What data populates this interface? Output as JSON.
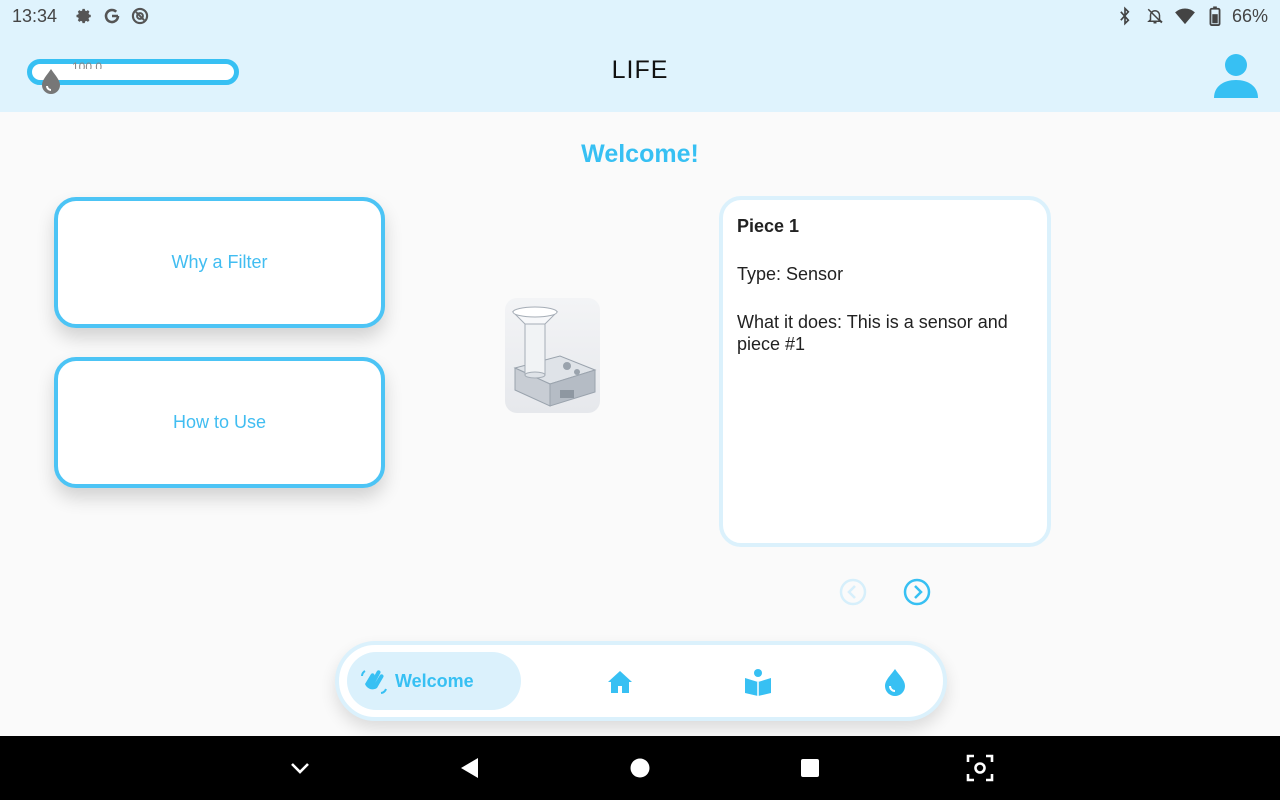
{
  "status_bar": {
    "time": "13:34",
    "left_icons": [
      "gear-icon",
      "google-icon",
      "data-saver-icon"
    ],
    "right_icons": [
      "bluetooth-icon",
      "notifications-off-icon",
      "wifi-icon",
      "battery-icon"
    ],
    "battery": "66%"
  },
  "app_bar": {
    "title": "LIFE",
    "water_pill_text": "100 0",
    "accent": "#37c0f3"
  },
  "main": {
    "welcome": "Welcome!",
    "buttons": [
      {
        "label": "Why a Filter"
      },
      {
        "label": "How to Use"
      }
    ],
    "piece": {
      "title": "Piece 1",
      "type": "Type: Sensor",
      "description": "What it does: This is a sensor and piece #1"
    }
  },
  "bottom_nav": {
    "items": [
      {
        "label": "Welcome",
        "icon": "waving-hand-icon",
        "active": true
      },
      {
        "label": "",
        "icon": "home-icon"
      },
      {
        "label": "",
        "icon": "reading-book-icon"
      },
      {
        "label": "",
        "icon": "water-drop-icon"
      }
    ]
  },
  "colors": {
    "accent": "#37c0f3",
    "bar_background": "#dff3fd",
    "active_pill": "#dbf1fc"
  }
}
